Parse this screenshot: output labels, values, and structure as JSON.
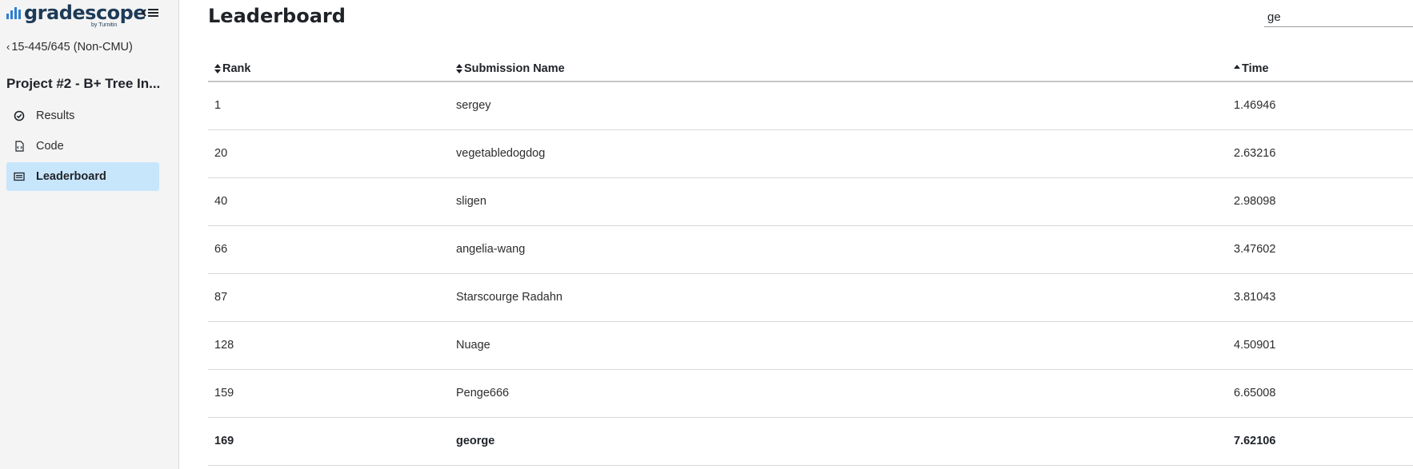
{
  "brand": {
    "logo_text": "gradescope",
    "logo_sub": "by Turnitin",
    "accent": "#2f7fd1"
  },
  "sidebar": {
    "back_label": "15-445/645 (Non-CMU)",
    "course_title": "Project #2 - B+ Tree In...",
    "items": [
      {
        "label": "Results",
        "icon": "check-circle-icon",
        "active": false
      },
      {
        "label": "Code",
        "icon": "code-file-icon",
        "active": false
      },
      {
        "label": "Leaderboard",
        "icon": "leaderboard-icon",
        "active": true
      }
    ],
    "active_bg": "#c8e6fb"
  },
  "main": {
    "title": "Leaderboard",
    "search": {
      "value": "ge",
      "placeholder": ""
    },
    "columns": {
      "rank": "Rank",
      "name": "Submission Name",
      "time": "Time"
    },
    "rows": [
      {
        "rank": "1",
        "name": "sergey",
        "time": "1.46946"
      },
      {
        "rank": "20",
        "name": "vegetabledogdog",
        "time": "2.63216"
      },
      {
        "rank": "40",
        "name": "sligen",
        "time": "2.98098"
      },
      {
        "rank": "66",
        "name": "angelia-wang",
        "time": "3.47602"
      },
      {
        "rank": "87",
        "name": "Starscourge Radahn",
        "time": "3.81043"
      },
      {
        "rank": "128",
        "name": "Nuage",
        "time": "4.50901"
      },
      {
        "rank": "159",
        "name": "Penge666",
        "time": "6.65008"
      },
      {
        "rank": "169",
        "name": "george",
        "time": "7.62106",
        "highlight": true
      }
    ]
  }
}
